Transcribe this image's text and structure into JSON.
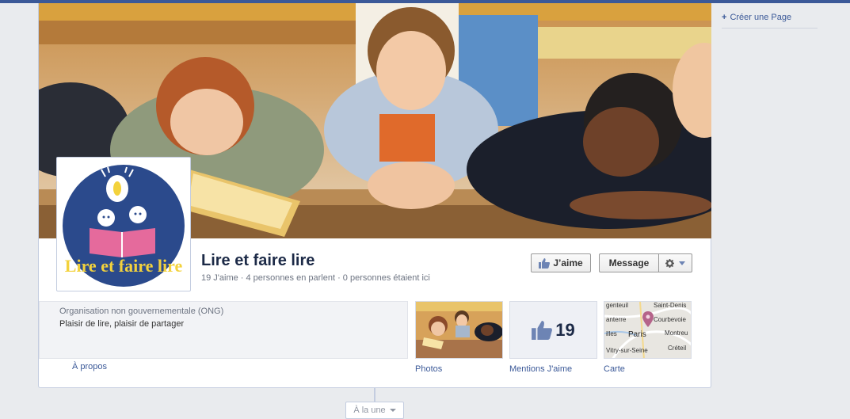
{
  "page": {
    "name": "Lire et faire lire",
    "stats": "19 J'aime · 4 personnes en parlent · 0 personnes étaient ici"
  },
  "profile": {
    "logo_text": "Lire et faire lire"
  },
  "actions": {
    "like_label": "J’aime",
    "message_label": "Message"
  },
  "about": {
    "category": "Organisation non gouvernementale (ONG)",
    "description": "Plaisir de lire, plaisir de partager",
    "link": "À propos"
  },
  "apps": {
    "photos_label": "Photos",
    "likes_label": "Mentions J'aime",
    "likes_count": "19",
    "map_label": "Carte",
    "map_places": [
      "genteuil",
      "Saint-Denis",
      "anterre",
      "Courbevoie",
      "illes",
      "Montreu",
      "Paris",
      "Créteil",
      "Vitry-sur-Seine"
    ]
  },
  "sidebar": {
    "create_page": "Créer une Page"
  },
  "timeline": {
    "year_selector": "À la une"
  },
  "colors": {
    "brand": "#3b5998",
    "logo_circle": "#2b4a8c",
    "logo_text": "#f3d23c",
    "book": "#e56a9c"
  }
}
